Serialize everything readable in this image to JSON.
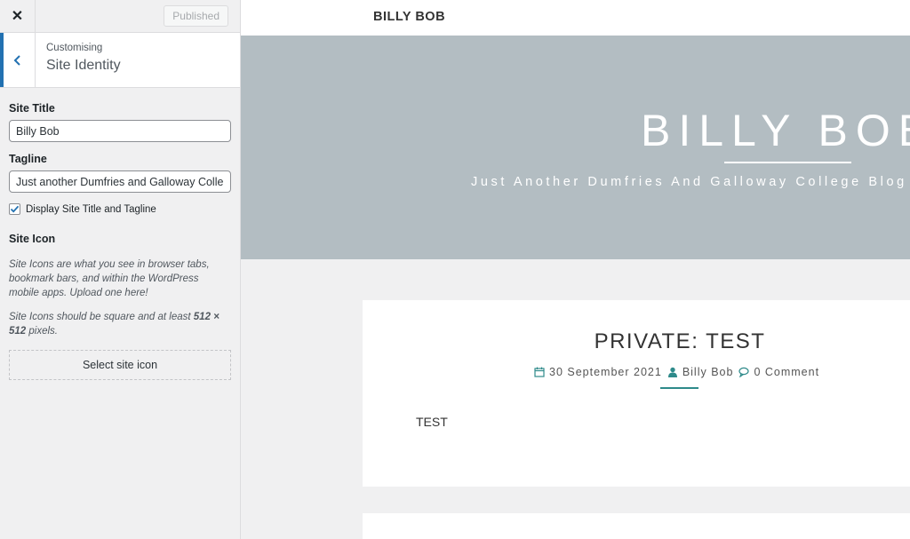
{
  "topbar": {
    "close_label": "✕",
    "publish_label": "Published"
  },
  "section": {
    "kicker": "Customising",
    "title": "Site Identity"
  },
  "controls": {
    "site_title_label": "Site Title",
    "site_title_value": "Billy Bob",
    "tagline_label": "Tagline",
    "tagline_value": "Just another Dumfries and Galloway College Blog",
    "display_checkbox_label": "Display Site Title and Tagline",
    "display_checked": true,
    "site_icon_label": "Site Icon",
    "site_icon_desc1": "Site Icons are what you see in browser tabs, bookmark bars, and within the WordPress mobile apps. Upload one here!",
    "site_icon_desc2_prefix": "Site Icons should be square and at least ",
    "site_icon_desc2_size": "512 × 512",
    "site_icon_desc2_suffix": " pixels.",
    "select_icon_label": "Select site icon"
  },
  "preview": {
    "brand": "BILLY BOB",
    "hero_title": "BILLY BOB",
    "hero_tagline": "Just Another Dumfries And Galloway College Blog",
    "post": {
      "title": "PRIVATE: TEST",
      "date": "30 September 2021",
      "author": "Billy Bob",
      "comments": "0 Comment",
      "body": "TEST"
    }
  },
  "colors": {
    "accent": "#2271b1",
    "hero_bg": "#b3bdc2",
    "meta_teal": "#2e8a8a"
  }
}
